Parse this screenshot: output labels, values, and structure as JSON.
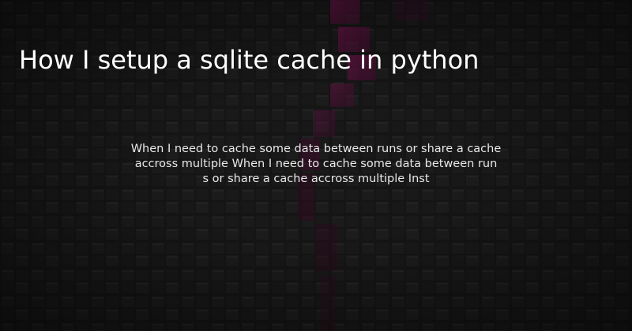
{
  "post": {
    "title": "How I setup a sqlite cache in python",
    "description_line_1": "When I need to cache some data between runs or share a cache",
    "description_line_2": "accross multiple When I need to cache some data between run",
    "description_line_3": "s or share a cache accross multiple Inst"
  },
  "colors": {
    "background": "#141414",
    "accent": "#6a1247",
    "title_text": "#ffffff",
    "description_text": "#e8e8e8"
  },
  "background_image": {
    "icon": "blocky-pixel-pattern"
  }
}
